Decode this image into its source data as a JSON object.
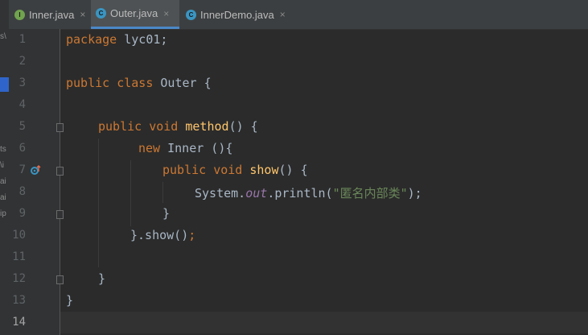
{
  "tabs": [
    {
      "label": "Inner.java",
      "icon": "interface-icon",
      "icon_letter": "I",
      "icon_color": "#71a34f",
      "active": false
    },
    {
      "label": "Outer.java",
      "icon": "class-icon",
      "icon_letter": "C",
      "icon_color": "#3a95c2",
      "active": true
    },
    {
      "label": "InnerDemo.java",
      "icon": "runnable-class-icon",
      "icon_letter": "C",
      "icon_color": "#3a95c2",
      "active": false
    }
  ],
  "close_glyph": "×",
  "left_fragments": [
    "s\\",
    "ts",
    "\\i",
    "ai",
    "ai",
    "ip"
  ],
  "line_numbers": [
    "1",
    "2",
    "3",
    "4",
    "5",
    "6",
    "7",
    "8",
    "9",
    "10",
    "11",
    "12",
    "13",
    "14"
  ],
  "code": {
    "l1": {
      "kw": "package",
      "rest": " lyc01;"
    },
    "l3": {
      "kw": "public class",
      "rest": " Outer {"
    },
    "l5": {
      "kw": "public void",
      "name": "method",
      "rest": "() {"
    },
    "l6": {
      "kw": "new",
      "rest": " Inner (){"
    },
    "l7": {
      "kw": "public void",
      "name": "show",
      "rest": "() {"
    },
    "l8": {
      "pre": "System.",
      "field": "out",
      "mid": ".println(",
      "str": "\"匿名内部类\"",
      "post": ");"
    },
    "l9": "}",
    "l10": {
      "pre": "}.show()",
      "kw": ";"
    },
    "l12": "}",
    "l13": "}"
  },
  "colors": {
    "keyword": "#cc7832",
    "method": "#ffc66d",
    "field": "#9876aa",
    "string": "#6a8759",
    "text": "#a9b7c6",
    "background": "#2b2b2b",
    "tab_accent": "#4a88c7"
  }
}
